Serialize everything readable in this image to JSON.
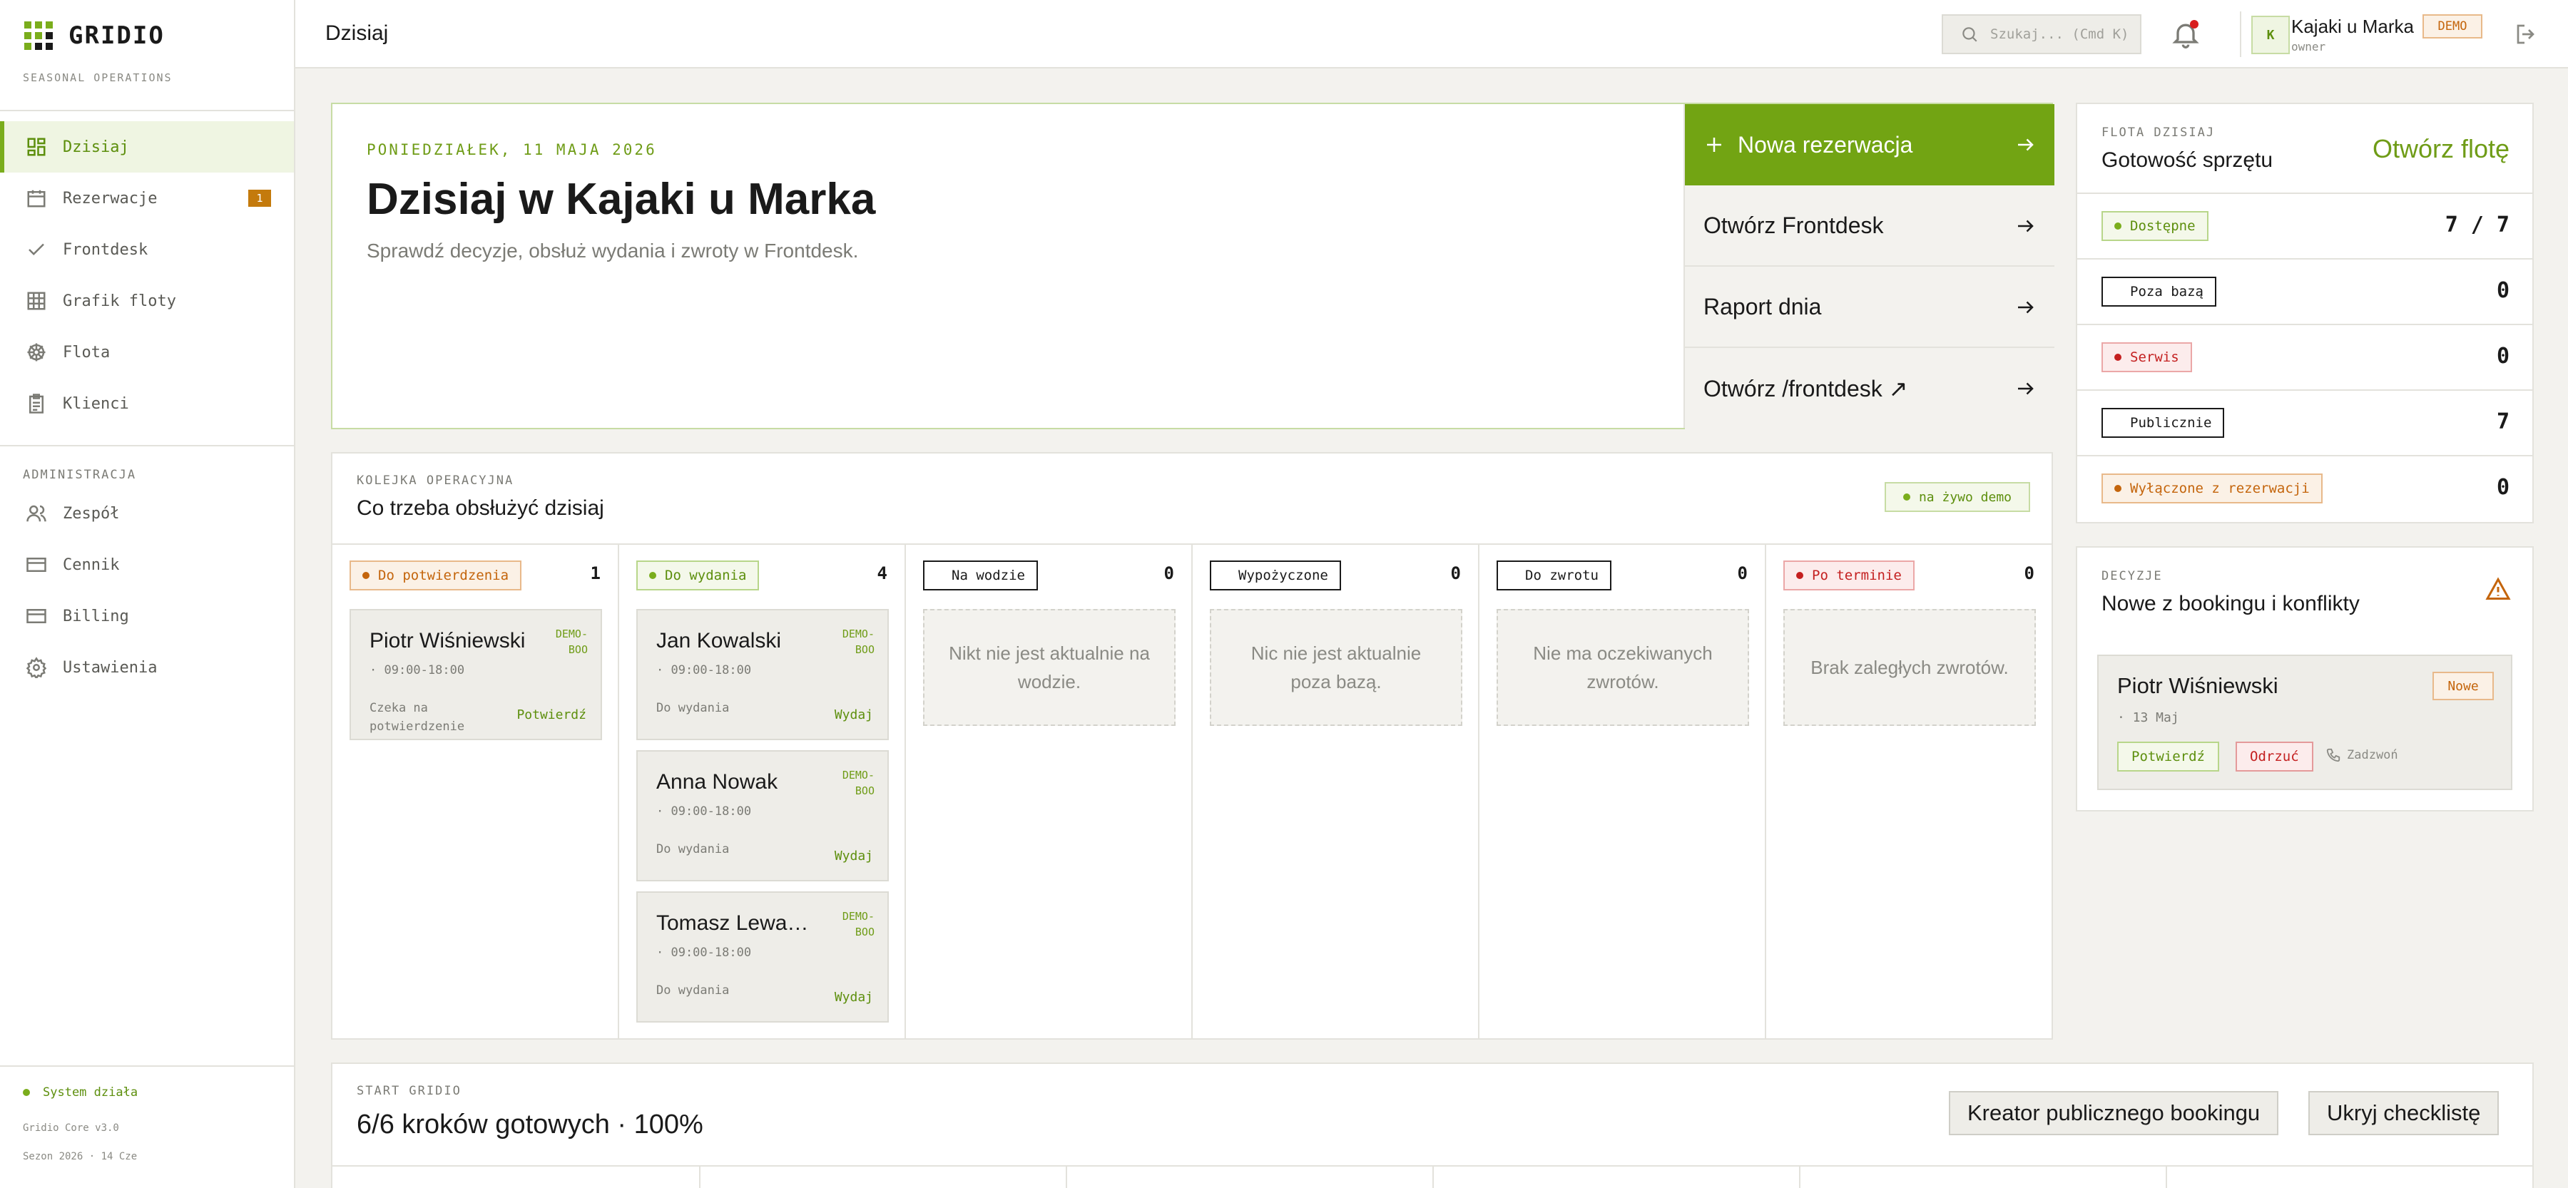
{
  "brand": {
    "name": "GRIDIO",
    "subtitle": "SEASONAL OPERATIONS"
  },
  "sidebar": {
    "nav": [
      {
        "label": "Dzisiaj",
        "icon": "dashboard-icon",
        "active": true
      },
      {
        "label": "Rezerwacje",
        "icon": "calendar-icon",
        "badge": "1"
      },
      {
        "label": "Frontdesk",
        "icon": "check-icon"
      },
      {
        "label": "Grafik floty",
        "icon": "grid-icon"
      },
      {
        "label": "Flota",
        "icon": "wheel-icon"
      },
      {
        "label": "Klienci",
        "icon": "clipboard-icon"
      }
    ],
    "admin_label": "ADMINISTRACJA",
    "admin": [
      {
        "label": "Zespół",
        "icon": "users-icon"
      },
      {
        "label": "Cennik",
        "icon": "card-icon"
      },
      {
        "label": "Billing",
        "icon": "card-icon"
      },
      {
        "label": "Ustawienia",
        "icon": "gear-icon"
      }
    ],
    "status": "System działa",
    "version": "Gridio Core v3.0",
    "season": "Sezon 2026 · 14 Cze"
  },
  "topbar": {
    "title": "Dzisiaj",
    "search_placeholder": "Szukaj... (Cmd K)",
    "user_initial": "K",
    "user_name": "Kajaki u Marka",
    "user_role": "owner",
    "demo": "DEMO"
  },
  "hero": {
    "date": "PONIEDZIAŁEK, 11 MAJA 2026",
    "title": "Dzisiaj w Kajaki u Marka",
    "subtitle": "Sprawdź decyzje, obsłuż wydania i zwroty w Frontdesk.",
    "actions": [
      "Nowa rezerwacja",
      "Otwórz Frontdesk",
      "Raport dnia",
      "Otwórz /frontdesk ↗"
    ]
  },
  "queue": {
    "label": "KOLEJKA OPERACYJNA",
    "title": "Co trzeba obsłużyć dzisiaj",
    "live": "na żywo demo",
    "columns": [
      {
        "label": "Do potwierdzenia",
        "count": "1",
        "cards": [
          {
            "name": "Piotr Wiśniewski",
            "tag": "DEMO-BOO",
            "time": "· 09:00-18:00",
            "status": "Czeka na potwierdzenie",
            "action": "Potwierdź"
          }
        ]
      },
      {
        "label": "Do wydania",
        "count": "4",
        "cards": [
          {
            "name": "Jan Kowalski",
            "tag": "DEMO-BOO",
            "time": "· 09:00-18:00",
            "status": "Do wydania",
            "action": "Wydaj"
          },
          {
            "name": "Anna Nowak",
            "tag": "DEMO-BOO",
            "time": "· 09:00-18:00",
            "status": "Do wydania",
            "action": "Wydaj"
          },
          {
            "name": "Tomasz Lewandowski",
            "tag": "DEMO-BOO",
            "time": "· 09:00-18:00",
            "status": "Do wydania",
            "action": "Wydaj"
          }
        ]
      },
      {
        "label": "Na wodzie",
        "count": "0",
        "empty": "Nikt nie jest aktualnie na wodzie."
      },
      {
        "label": "Wypożyczone",
        "count": "0",
        "empty": "Nic nie jest aktualnie poza bazą."
      },
      {
        "label": "Do zwrotu",
        "count": "0",
        "empty": "Nie ma oczekiwanych zwrotów."
      },
      {
        "label": "Po terminie",
        "count": "0",
        "empty": "Brak zaległych zwrotów."
      }
    ]
  },
  "fleet": {
    "label": "FLOTA DZISIAJ",
    "title": "Gotowość sprzętu",
    "link": "Otwórz flotę",
    "rows": [
      {
        "label": "Dostępne",
        "value": "7 / 7"
      },
      {
        "label": "Poza bazą",
        "value": "0"
      },
      {
        "label": "Serwis",
        "value": "0"
      },
      {
        "label": "Publicznie",
        "value": "7"
      },
      {
        "label": "Wyłączone z rezerwacji",
        "value": "0"
      }
    ]
  },
  "decisions": {
    "label": "DECYZJE",
    "title": "Nowe z bookingu i konflikty",
    "card": {
      "name": "Piotr Wiśniewski",
      "badge": "Nowe",
      "date": "· 13 Maj",
      "confirm": "Potwierdź",
      "reject": "Odrzuć",
      "call": "Zadzwoń"
    }
  },
  "start": {
    "label": "START GRIDIO",
    "title": "6/6 kroków gotowych · 100%",
    "btn_booking": "Kreator publicznego bookingu",
    "btn_hide": "Ukryj checklistę"
  },
  "colors": {
    "accent": "#72a413",
    "accent_text": "#6f9c17",
    "warning": "#c4650c",
    "danger": "#c42020"
  }
}
